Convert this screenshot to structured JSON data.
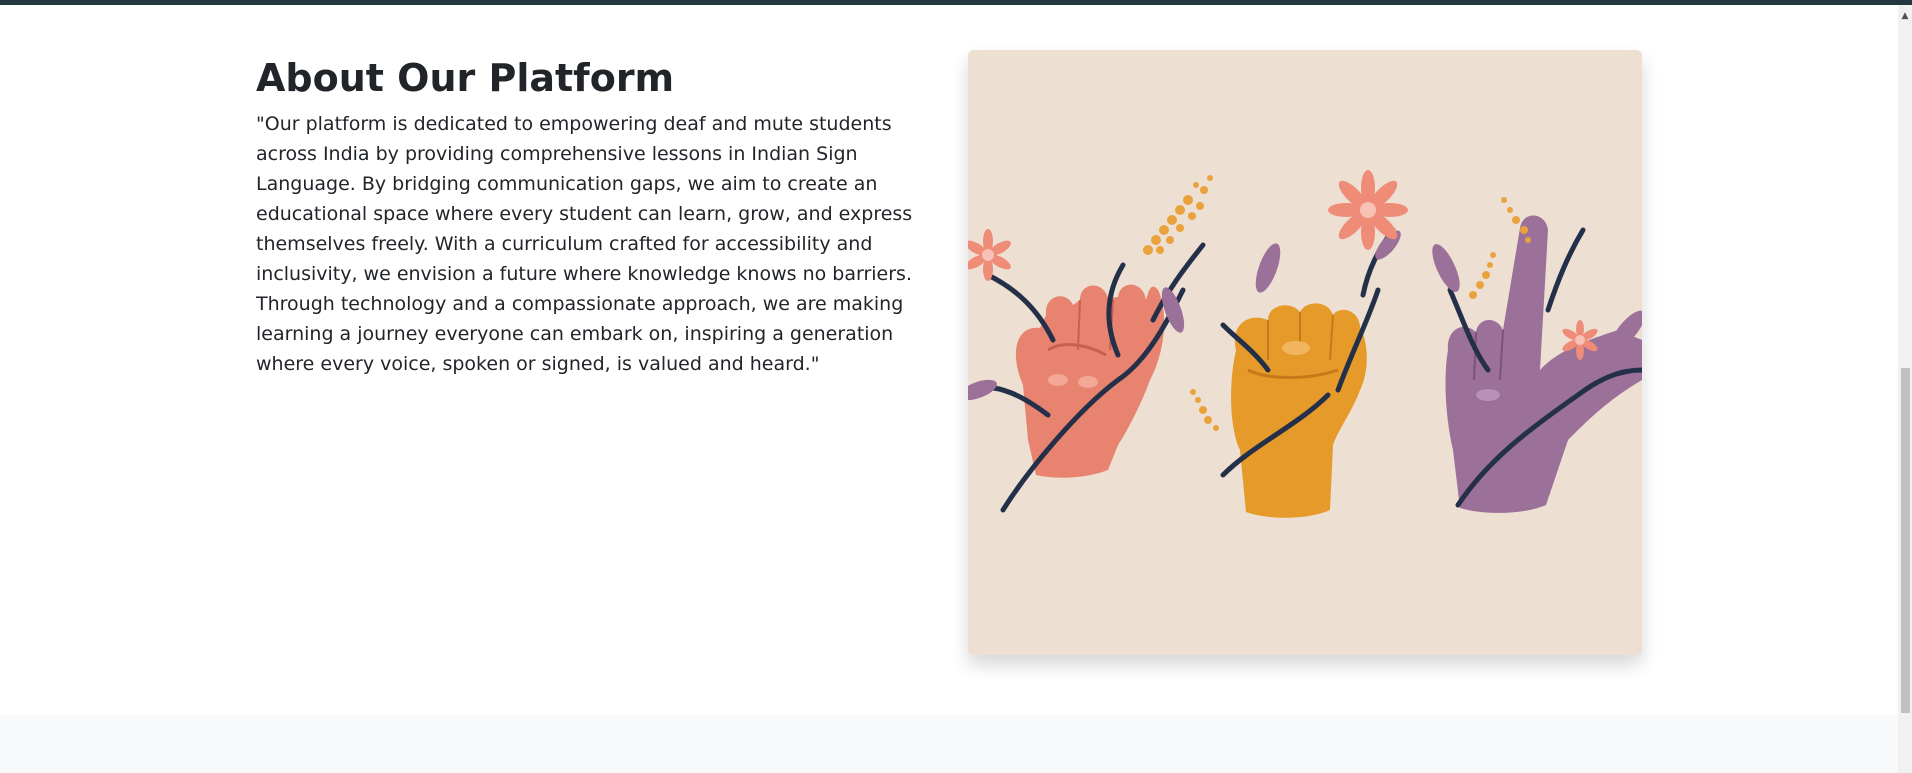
{
  "about": {
    "title": "About Our Platform",
    "body": "\"Our platform is dedicated to empowering deaf and mute students across India by providing comprehensive lessons in Indian Sign Language. By bridging communication gaps, we aim to create an educational space where every student can learn, grow, and express themselves freely. With a curriculum crafted for accessibility and inclusivity, we envision a future where knowledge knows no barriers. Through technology and a compassionate approach, we are making learning a journey everyone can embark on, inspiring a generation where every voice, spoken or signed, is valued and heard.\""
  },
  "illustration": {
    "background_color": "#eddfd1",
    "hand_colors": [
      "#e8836f",
      "#e59a2a",
      "#9b7099"
    ],
    "vine_color": "#24304a",
    "flower_color": "#ee8c78",
    "bloom_color": "#eaa23c"
  },
  "scrollbar": {
    "arrow_up_icon": "triangle-up"
  },
  "colors": {
    "top_bar": "#23383f",
    "text": "#212529",
    "footer_bg": "#f8f9fa"
  }
}
